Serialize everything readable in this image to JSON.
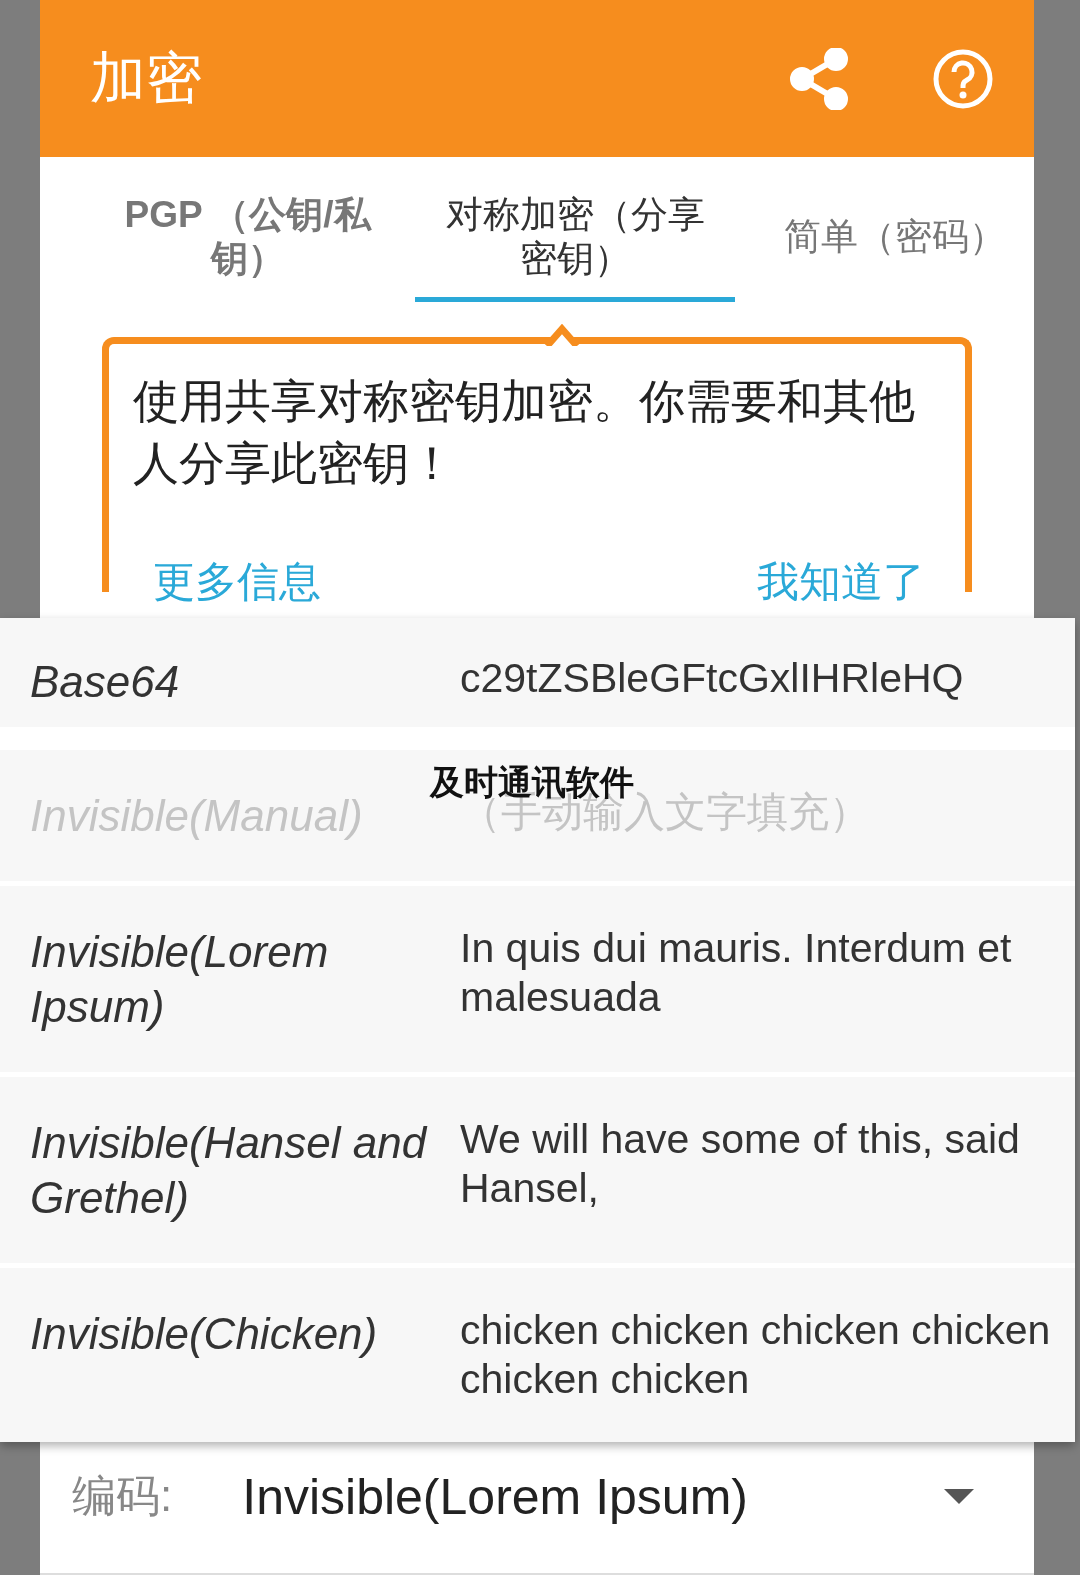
{
  "header": {
    "title": "加密"
  },
  "tabs": [
    {
      "label": "PGP （公钥/私钥）",
      "selected": false
    },
    {
      "label": "对称加密（分享密钥）",
      "selected": true
    },
    {
      "label": "简单（密码）",
      "selected": false
    }
  ],
  "tip": {
    "text": "使用共享对称密钥加密。你需要和其他人分享此密钥！",
    "links": [
      "更多信息",
      "我知道了"
    ]
  },
  "menu": [
    {
      "label": "Base64",
      "value": "c29tZSBleGFtcGxlIHRleHQ",
      "disabled": false
    },
    {
      "label": "Invisible(Manual)",
      "value": "（手动输入文字填充）",
      "disabled": true
    },
    {
      "label": "Invisible(Lorem Ipsum)",
      "value": "In quis dui mauris. Interdum et malesuada",
      "disabled": false
    },
    {
      "label": "Invisible(Hansel and Grethel)",
      "value": "We will have some of this, said Hansel,",
      "disabled": false
    },
    {
      "label": "Invisible(Chicken)",
      "value": "chicken chicken chicken chicken chicken chicken",
      "disabled": false
    }
  ],
  "annotation": "及时通讯软件",
  "encoding": {
    "label": "编码:",
    "value": "Invisible(Lorem Ipsum)"
  }
}
